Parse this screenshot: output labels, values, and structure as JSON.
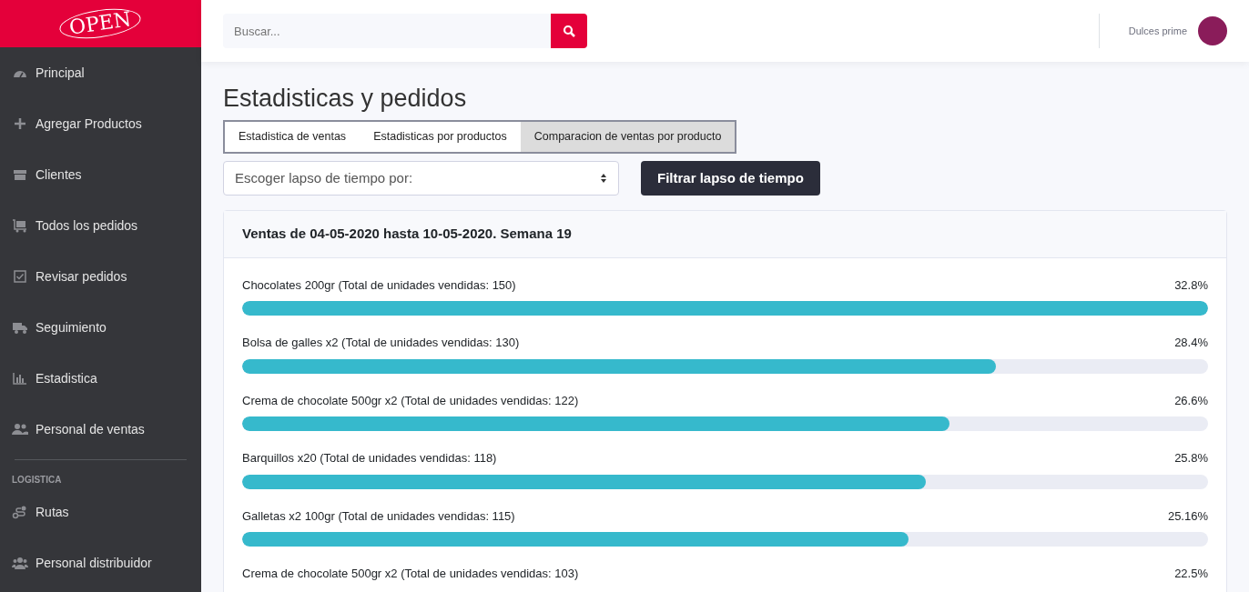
{
  "logo": {
    "text": "OPEN"
  },
  "sidebar": {
    "items": [
      {
        "label": "Principal"
      },
      {
        "label": "Agregar Productos"
      },
      {
        "label": "Clientes"
      },
      {
        "label": "Todos los pedidos"
      },
      {
        "label": "Revisar pedidos"
      },
      {
        "label": "Seguimiento"
      },
      {
        "label": "Estadistica"
      },
      {
        "label": "Personal de ventas"
      }
    ],
    "section": {
      "heading": "LOGISTICA",
      "items": [
        {
          "label": "Rutas"
        },
        {
          "label": "Personal distribuidor"
        }
      ]
    }
  },
  "search": {
    "placeholder": "Buscar..."
  },
  "user": {
    "name": "Dulces prime"
  },
  "page_title": "Estadisticas y pedidos",
  "tabs": [
    {
      "label": "Estadistica de ventas",
      "selected": false
    },
    {
      "label": "Estadisticas por productos",
      "selected": false
    },
    {
      "label": "Comparacion de ventas por producto",
      "selected": true
    }
  ],
  "period_select": {
    "value": "Escoger lapso de tiempo por:"
  },
  "filter_button": "Filtrar lapso de tiempo",
  "card": {
    "title": "Ventas de 04-05-2020 hasta 10-05-2020. Semana 19",
    "products": [
      {
        "label": "Chocolates 200gr (Total de unidades vendidas: 150)",
        "percent": "32.8%",
        "level": 1
      },
      {
        "label": "Bolsa de galles x2 (Total de unidades vendidas: 130)",
        "percent": "28.4%",
        "level": 0.78
      },
      {
        "label": "Crema de chocolate 500gr x2 (Total de unidades vendidas: 122)",
        "percent": "26.6%",
        "level": 0.732
      },
      {
        "label": "Barquillos x20 (Total de unidades vendidas: 118)",
        "percent": "25.8%",
        "level": 0.708
      },
      {
        "label": "Galletas x2 100gr (Total de unidades vendidas: 115)",
        "percent": "25.16%",
        "level": 0.69
      },
      {
        "label": "Crema de chocolate 500gr x2 (Total de unidades vendidas: 103)",
        "percent": "22.5%"
      }
    ]
  }
}
